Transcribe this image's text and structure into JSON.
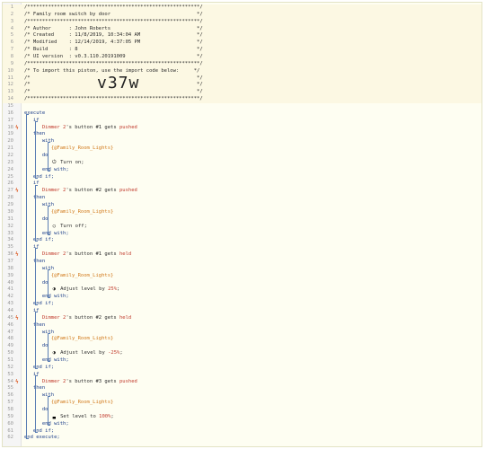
{
  "editor": {
    "lines": [
      {
        "n": "1",
        "text": "/**********************************************************/",
        "hdr": true
      },
      {
        "n": "2",
        "text": "/* Family room switch by door                             */",
        "hdr": true
      },
      {
        "n": "3",
        "text": "/**********************************************************/",
        "hdr": true
      },
      {
        "n": "4",
        "text": "/* Author      : John Roberts                             */",
        "hdr": true
      },
      {
        "n": "5",
        "text": "/* Created     : 11/8/2019, 10:34:04 AM                   */",
        "hdr": true
      },
      {
        "n": "6",
        "text": "/* Modified    : 12/14/2019, 4:37:05 PM                   */",
        "hdr": true
      },
      {
        "n": "7",
        "text": "/* Build       : 8                                        */",
        "hdr": true
      },
      {
        "n": "8",
        "text": "/* UI version  : v0.3.110.20191009                        */",
        "hdr": true
      },
      {
        "n": "9",
        "text": "/**********************************************************/",
        "hdr": true
      },
      {
        "n": "10",
        "text": "/* To import this piston, use the import code below:     */",
        "hdr": true
      },
      {
        "n": "11",
        "text": "/*                                                        */",
        "hdr": true
      },
      {
        "n": "12",
        "text": "/*                                                        */",
        "hdr": true
      },
      {
        "n": "13",
        "text": "/*                                                        */",
        "hdr": true
      },
      {
        "n": "14",
        "text": "/**********************************************************/",
        "hdr": true
      },
      {
        "n": "15",
        "text": ""
      },
      {
        "n": "16",
        "text": "execute",
        "kind": "kw"
      },
      {
        "n": "17",
        "text": "   if",
        "kind": "kw"
      },
      {
        "n": "18",
        "mark": "ϟ",
        "parts": [
          [
            "      ",
            ""
          ],
          [
            "Dimmer 2",
            "dev"
          ],
          [
            "'s button #1 gets ",
            ""
          ],
          [
            "pushed",
            "evt"
          ]
        ]
      },
      {
        "n": "19",
        "text": "   then",
        "kind": "kw"
      },
      {
        "n": "20",
        "text": "      with",
        "kind": "kw"
      },
      {
        "n": "21",
        "parts": [
          [
            "         ",
            ""
          ],
          [
            "{@Family_Room_Lights}",
            "var"
          ]
        ]
      },
      {
        "n": "22",
        "text": "      do",
        "kind": "kw"
      },
      {
        "n": "23",
        "parts": [
          [
            "         ",
            ""
          ],
          [
            "⏻",
            "sym"
          ],
          [
            " Turn on;",
            ""
          ]
        ]
      },
      {
        "n": "24",
        "text": "      end with;",
        "kind": "kw"
      },
      {
        "n": "25",
        "text": "   end if;",
        "kind": "kw"
      },
      {
        "n": "26",
        "text": "   if",
        "kind": "kw"
      },
      {
        "n": "27",
        "mark": "ϟ",
        "parts": [
          [
            "      ",
            ""
          ],
          [
            "Dimmer 2",
            "dev"
          ],
          [
            "'s button #2 gets ",
            ""
          ],
          [
            "pushed",
            "evt"
          ]
        ]
      },
      {
        "n": "28",
        "text": "   then",
        "kind": "kw"
      },
      {
        "n": "29",
        "text": "      with",
        "kind": "kw"
      },
      {
        "n": "30",
        "parts": [
          [
            "         ",
            ""
          ],
          [
            "{@Family_Room_Lights}",
            "var"
          ]
        ]
      },
      {
        "n": "31",
        "text": "      do",
        "kind": "kw"
      },
      {
        "n": "32",
        "parts": [
          [
            "         ",
            ""
          ],
          [
            "○",
            "sym"
          ],
          [
            " Turn off;",
            ""
          ]
        ]
      },
      {
        "n": "33",
        "text": "      end with;",
        "kind": "kw"
      },
      {
        "n": "34",
        "text": "   end if;",
        "kind": "kw"
      },
      {
        "n": "35",
        "text": "   if",
        "kind": "kw"
      },
      {
        "n": "36",
        "mark": "ϟ",
        "parts": [
          [
            "      ",
            ""
          ],
          [
            "Dimmer 2",
            "dev"
          ],
          [
            "'s button #1 gets ",
            ""
          ],
          [
            "held",
            "evt"
          ]
        ]
      },
      {
        "n": "37",
        "text": "   then",
        "kind": "kw"
      },
      {
        "n": "38",
        "text": "      with",
        "kind": "kw"
      },
      {
        "n": "39",
        "parts": [
          [
            "         ",
            ""
          ],
          [
            "{@Family_Room_Lights}",
            "var"
          ]
        ]
      },
      {
        "n": "40",
        "text": "      do",
        "kind": "kw"
      },
      {
        "n": "41",
        "parts": [
          [
            "         ",
            ""
          ],
          [
            "◑",
            "sym"
          ],
          [
            " Adjust level by ",
            ""
          ],
          [
            "25%",
            "val"
          ],
          [
            ";",
            ""
          ]
        ]
      },
      {
        "n": "42",
        "text": "      end with;",
        "kind": "kw"
      },
      {
        "n": "43",
        "text": "   end if;",
        "kind": "kw"
      },
      {
        "n": "44",
        "text": "   if",
        "kind": "kw"
      },
      {
        "n": "45",
        "mark": "ϟ",
        "parts": [
          [
            "      ",
            ""
          ],
          [
            "Dimmer 2",
            "dev"
          ],
          [
            "'s button #2 gets ",
            ""
          ],
          [
            "held",
            "evt"
          ]
        ]
      },
      {
        "n": "46",
        "text": "   then",
        "kind": "kw"
      },
      {
        "n": "47",
        "text": "      with",
        "kind": "kw"
      },
      {
        "n": "48",
        "parts": [
          [
            "         ",
            ""
          ],
          [
            "{@Family_Room_Lights}",
            "var"
          ]
        ]
      },
      {
        "n": "49",
        "text": "      do",
        "kind": "kw"
      },
      {
        "n": "50",
        "parts": [
          [
            "         ",
            ""
          ],
          [
            "◑",
            "sym"
          ],
          [
            " Adjust level by ",
            ""
          ],
          [
            "-25%",
            "val"
          ],
          [
            ";",
            ""
          ]
        ]
      },
      {
        "n": "51",
        "text": "      end with;",
        "kind": "kw"
      },
      {
        "n": "52",
        "text": "   end if;",
        "kind": "kw"
      },
      {
        "n": "53",
        "text": "   if",
        "kind": "kw"
      },
      {
        "n": "54",
        "mark": "ϟ",
        "parts": [
          [
            "      ",
            ""
          ],
          [
            "Dimmer 2",
            "dev"
          ],
          [
            "'s button #3 gets ",
            ""
          ],
          [
            "pushed",
            "evt"
          ]
        ]
      },
      {
        "n": "55",
        "text": "   then",
        "kind": "kw"
      },
      {
        "n": "56",
        "text": "      with",
        "kind": "kw"
      },
      {
        "n": "57",
        "parts": [
          [
            "         ",
            ""
          ],
          [
            "{@Family_Room_Lights}",
            "var"
          ]
        ]
      },
      {
        "n": "58",
        "text": "      do",
        "kind": "kw"
      },
      {
        "n": "59",
        "parts": [
          [
            "         ",
            ""
          ],
          [
            "▃",
            "sym"
          ],
          [
            " Set level to ",
            ""
          ],
          [
            "100%",
            "val"
          ],
          [
            ";",
            ""
          ]
        ]
      },
      {
        "n": "60",
        "text": "      end with;",
        "kind": "kw"
      },
      {
        "n": "61",
        "text": "   end if;",
        "kind": "kw"
      },
      {
        "n": "62",
        "text": "end execute;",
        "kind": "kw"
      }
    ],
    "import_code": "v37w"
  },
  "colors": {
    "background": "#fefef2",
    "keyword": "#1c3e8a",
    "device": "#c0392b",
    "variable": "#d27a1c",
    "rail": "#5b7fb4",
    "trigger_mark": "#e06a38"
  },
  "icons": {
    "trigger_mark": "lightning-bolt-icon",
    "turn_on": "power-icon",
    "turn_off": "circle-icon",
    "adjust_level": "half-circle-icon",
    "set_level": "level-bars-icon"
  }
}
